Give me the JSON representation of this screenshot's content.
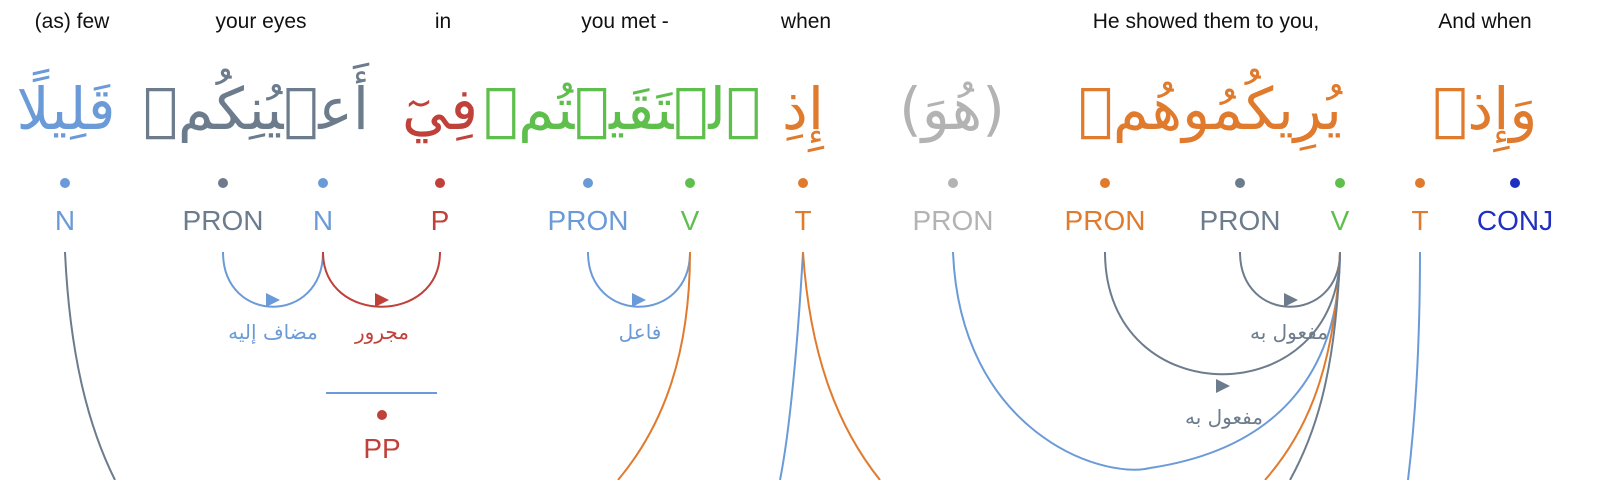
{
  "colors": {
    "blue": "#6a9bd8",
    "slate": "#6c7c8c",
    "red": "#c0403a",
    "green": "#5fbf4d",
    "orange": "#e07b2e",
    "gray": "#b3b3b3",
    "navy": "#1f2fbf"
  },
  "glosses": {
    "g1": "(as) few",
    "g2": "your eyes",
    "g3": "in",
    "g4": "you met -",
    "g5": "when",
    "g6": "He showed them to you,",
    "g7": "And when"
  },
  "words": {
    "w1": "قَلِيلًا",
    "w2": "أَعۡيُنِكُمۡ",
    "w3": "فِيٓ",
    "w4": "ٱلۡتَقَيۡتُمۡ",
    "w5": "إِذِ",
    "w6": "(هُوَ)",
    "w7": "يُرِيكُمُوهُمۡ",
    "w8": "وَإِذۡ"
  },
  "tags": {
    "t1": "N",
    "t2": "PRON",
    "t3": "N",
    "t4": "P",
    "t5": "PRON",
    "t6": "V",
    "t7": "T",
    "t8": "PRON",
    "t9": "PRON",
    "t10": "PRON",
    "t11": "V",
    "t12": "T",
    "t13": "CONJ"
  },
  "relations": {
    "r1": "مضاف إليه",
    "r2": "مجرور",
    "r3": "فاعل",
    "r4": "مفعول به",
    "r5": "مفعول به"
  },
  "phrase": {
    "pp": "PP"
  }
}
